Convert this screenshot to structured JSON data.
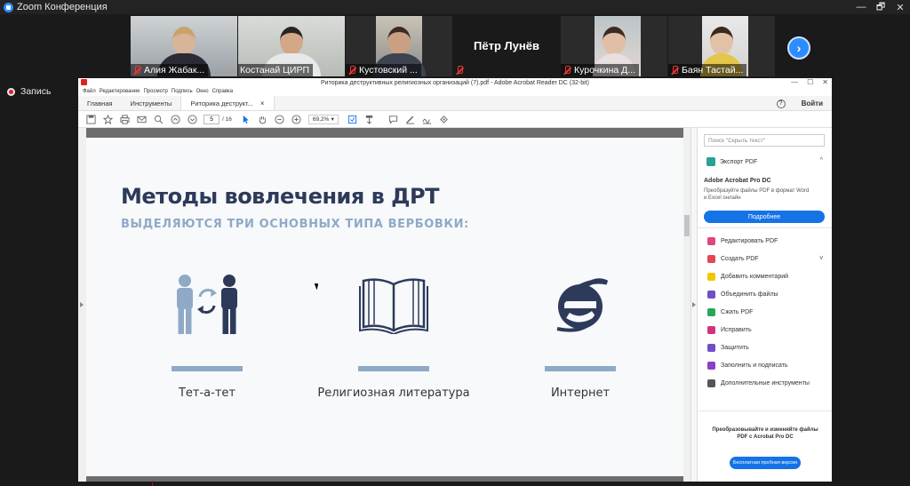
{
  "zoom": {
    "window_title": "Zoom Конференция",
    "window_controls": [
      "—",
      "🗗",
      "✕"
    ],
    "participants": [
      {
        "name": "Алия Жабак...",
        "muted": true
      },
      {
        "name": "Костанай ЦИРП",
        "muted": false,
        "active_speaker": true
      },
      {
        "name": "Кустовский ...",
        "muted": true
      },
      {
        "name": "Пётр Лунёв",
        "muted": true,
        "video": false
      },
      {
        "name": "Курочкина Д...",
        "muted": true
      },
      {
        "name": "Баян Тастай...",
        "muted": true
      }
    ],
    "next_page_glyph": "›",
    "recording_label": "Запись"
  },
  "acrobat": {
    "title": "Риторика деструктивных религиозных организаций (7).pdf - Adobe Acrobat Reader DC (32-bit)",
    "title_controls": [
      "—",
      "☐",
      "✕"
    ],
    "menu": [
      "Файл",
      "Редактирование",
      "Просмотр",
      "Подпись",
      "Окно",
      "Справка"
    ],
    "tabs": {
      "home": "Главная",
      "tools": "Инструменты",
      "document": "Риторика деструкт..."
    },
    "tab_close": "×",
    "help_glyph": "?",
    "login": "Войти",
    "page_current": "5",
    "page_total": "/ 16",
    "zoom_level": "69,2%",
    "zoom_arrow": "▾",
    "search_placeholder": "Поиск \"Скрыть текст\"",
    "export_pdf": "Экспорт PDF",
    "export_chevron": "^",
    "promo_title": "Adobe Acrobat Pro DC",
    "promo_text": "Преобразуйте файлы PDF в формат Word и Excel онлайн",
    "promo_button": "Подробнее",
    "tools": [
      {
        "label": "Редактировать PDF",
        "icon": "edit-pdf-icon",
        "color": "#e0457b"
      },
      {
        "label": "Создать PDF",
        "icon": "create-pdf-icon",
        "color": "#e34850",
        "chevron": "v"
      },
      {
        "label": "Добавить комментарий",
        "icon": "comment-icon",
        "color": "#f5c400"
      },
      {
        "label": "Объединить файлы",
        "icon": "combine-icon",
        "color": "#6e4fc7"
      },
      {
        "label": "Сжать PDF",
        "icon": "compress-icon",
        "color": "#26a65b"
      },
      {
        "label": "Исправить",
        "icon": "fix-icon",
        "color": "#d1347e"
      },
      {
        "label": "Защитить",
        "icon": "protect-icon",
        "color": "#6e4fc7"
      },
      {
        "label": "Заполнить и подписать",
        "icon": "fill-sign-icon",
        "color": "#8a3fc7"
      },
      {
        "label": "Дополнительные инструменты",
        "icon": "more-tools-icon",
        "color": "#555555"
      }
    ],
    "bottom_promo": "Преобразовывайте и изменяйте файлы PDF с Acrobat Pro DC",
    "bottom_button": "Бесплатная пробная версия"
  },
  "slide": {
    "title": "Методы вовлечения в ДРТ",
    "subtitle": "ВЫДЕЛЯЮТСЯ ТРИ ОСНОВНЫХ ТИПА ВЕРБОВКИ:",
    "methods": [
      {
        "label": "Тет-а-тет",
        "icon": "two-people-icon"
      },
      {
        "label": "Религиозная литература",
        "icon": "open-book-icon"
      },
      {
        "label": "Интернет",
        "icon": "internet-explorer-icon"
      }
    ],
    "colors": {
      "title": "#2d3a59",
      "subtitle": "#8fa9c6",
      "bar": "#8fa9c6",
      "icon_dark": "#2d3a59"
    }
  }
}
